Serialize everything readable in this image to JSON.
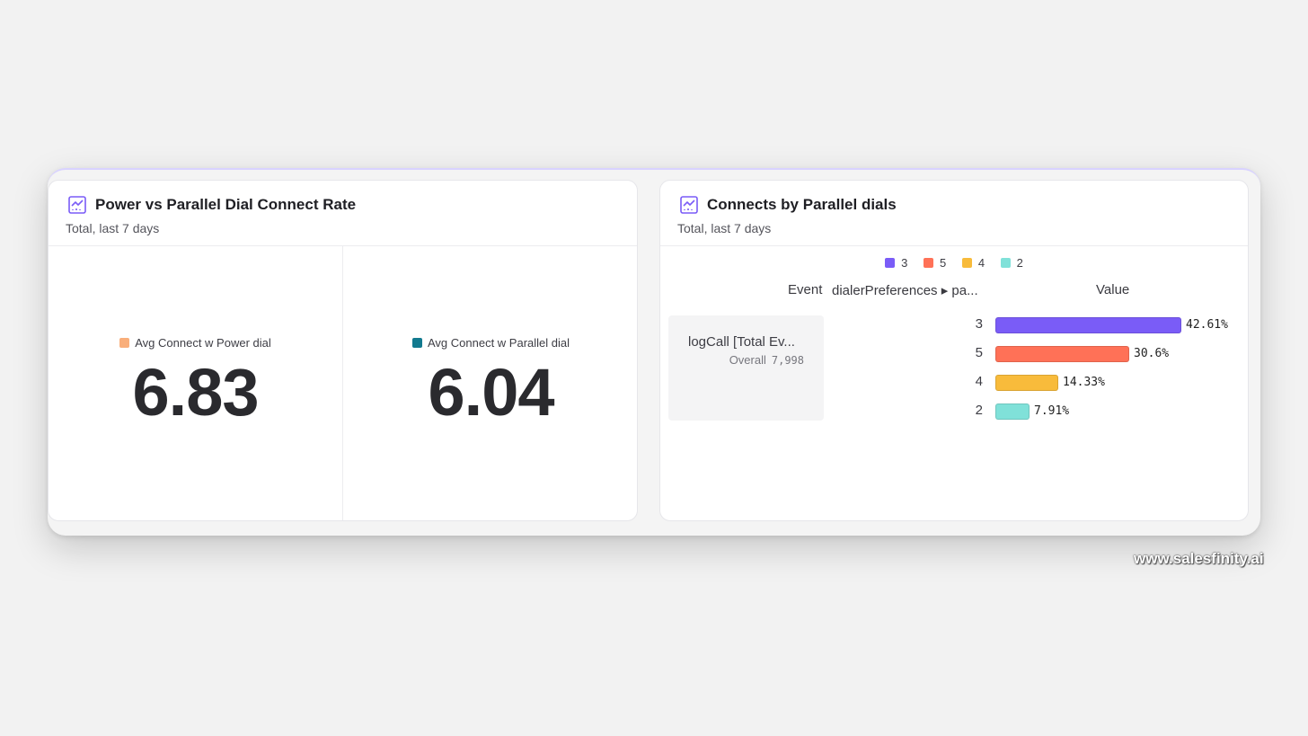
{
  "cards": [
    {
      "title": "Power vs Parallel Dial Connect Rate",
      "subtitle": "Total, last 7 days",
      "icon": "line-chart-icon",
      "metrics": [
        {
          "label": "Avg Connect w Power dial",
          "value": "6.83",
          "color": "#f9ae7a"
        },
        {
          "label": "Avg Connect w Parallel dial",
          "value": "6.04",
          "color": "#127a8f"
        }
      ]
    },
    {
      "title": "Connects by Parallel dials",
      "subtitle": "Total, last 7 days",
      "icon": "line-chart-icon"
    }
  ],
  "chart_data": {
    "type": "bar",
    "orientation": "horizontal",
    "legend": [
      "3",
      "5",
      "4",
      "2"
    ],
    "columns": {
      "event": "Event",
      "breakdown": "dialerPreferences ▸ pa...",
      "value": "Value"
    },
    "event": {
      "name": "logCall [Total Ev...",
      "overall_label": "Overall",
      "overall_value": "7,998"
    },
    "categories": [
      "3",
      "5",
      "4",
      "2"
    ],
    "values": [
      42.61,
      30.6,
      14.33,
      7.91
    ],
    "value_labels": [
      "42.61%",
      "30.6%",
      "14.33%",
      "7.91%"
    ],
    "colors": [
      "#7a5cf7",
      "#ff7157",
      "#f8bb3b",
      "#80e1d9"
    ],
    "xlim": [
      0,
      42.61
    ]
  },
  "watermark": "www.salesfinity.ai"
}
